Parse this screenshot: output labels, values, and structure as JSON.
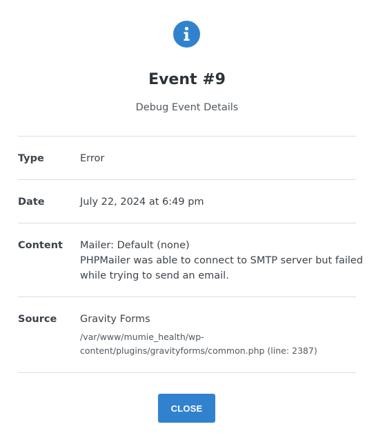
{
  "dialog": {
    "title": "Event #9",
    "subtitle": "Debug Event Details",
    "icon": "info-icon",
    "accent_color": "#3182ce"
  },
  "details": {
    "type": {
      "label": "Type",
      "value": "Error"
    },
    "date": {
      "label": "Date",
      "value": "July 22, 2024 at 6:49 pm"
    },
    "content": {
      "label": "Content",
      "lines": [
        "Mailer: Default (none)",
        "PHPMailer was able to connect to SMTP server but failed",
        "while trying to send an email."
      ]
    },
    "source": {
      "label": "Source",
      "value": "Gravity Forms",
      "path_lines": [
        "/var/www/mumie_health/wp-",
        "content/plugins/gravityforms/common.php (line: 2387)"
      ]
    }
  },
  "actions": {
    "close_label": "CLOSE"
  }
}
